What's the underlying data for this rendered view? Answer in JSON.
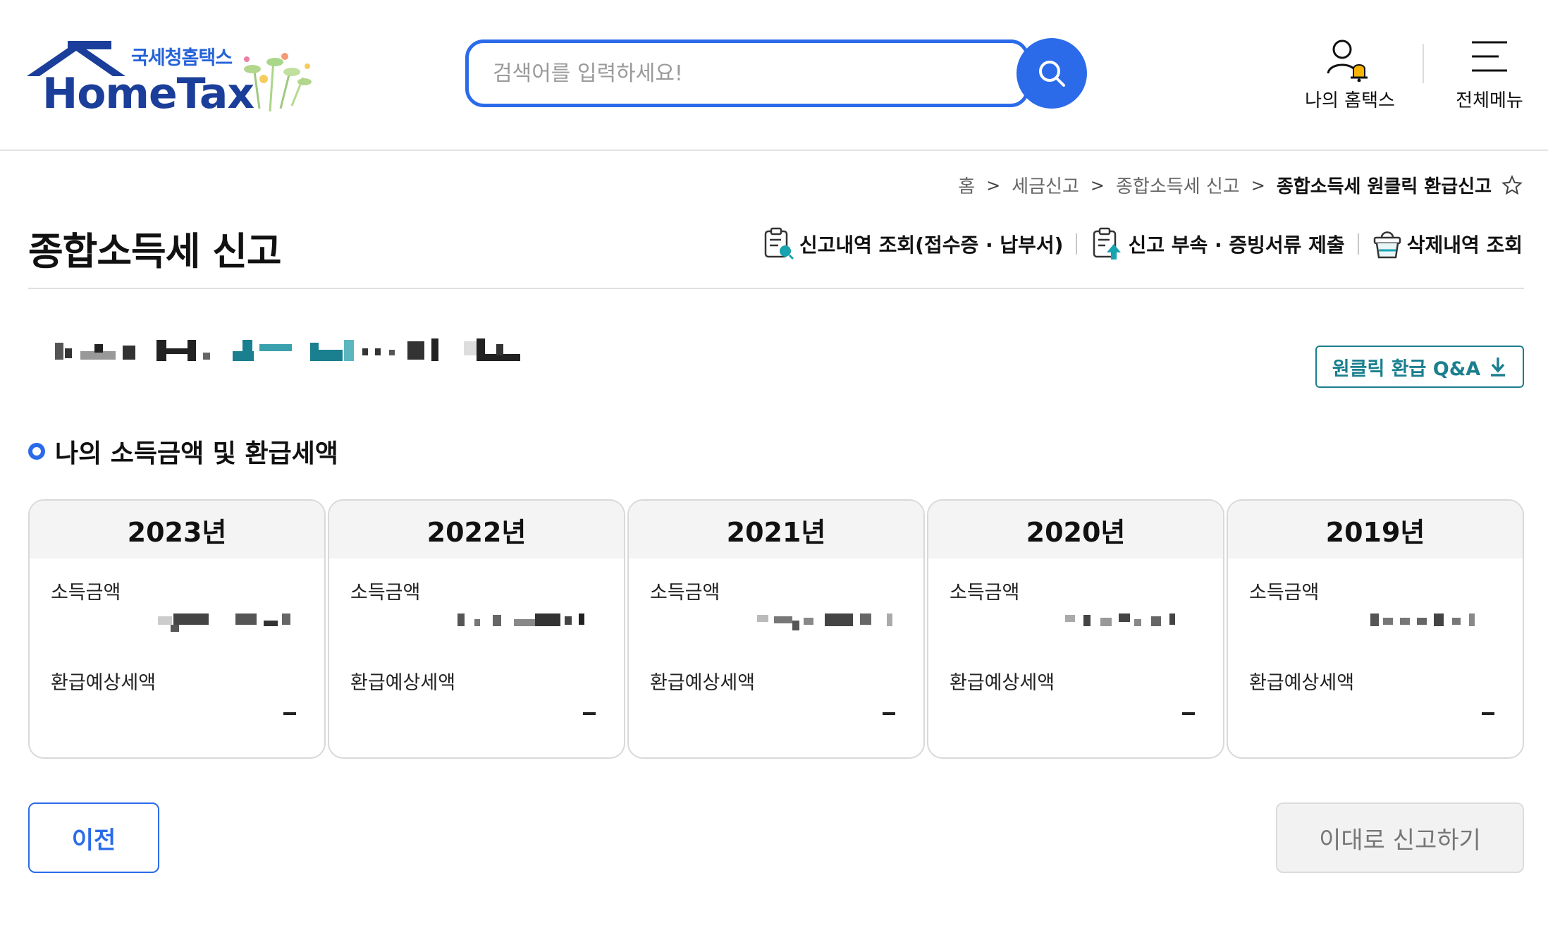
{
  "header": {
    "logo_sub": "국세청홈택스",
    "logo_main": "HomeTax",
    "search_placeholder": "검색어를 입력하세요!",
    "my_hometax": "나의 홈택스",
    "all_menu": "전체메뉴"
  },
  "breadcrumb": [
    "홈",
    "세금신고",
    "종합소득세 신고",
    "종합소득세 원클릭 환급신고"
  ],
  "page_title": "종합소득세 신고",
  "actions": {
    "history": "신고내역 조회(접수증 · 납부서)",
    "attach": "신고 부속 · 증빙서류 제출",
    "deleted": "삭제내역 조회"
  },
  "qa_button": "원클릭 환급 Q&A",
  "section_title": "나의 소득금액 및 환급세액",
  "cards": [
    {
      "year": "2023년",
      "income_label": "소득금액",
      "refund_label": "환급예상세액",
      "refund_value": "-"
    },
    {
      "year": "2022년",
      "income_label": "소득금액",
      "refund_label": "환급예상세액",
      "refund_value": "-"
    },
    {
      "year": "2021년",
      "income_label": "소득금액",
      "refund_label": "환급예상세액",
      "refund_value": "-"
    },
    {
      "year": "2020년",
      "income_label": "소득금액",
      "refund_label": "환급예상세액",
      "refund_value": "-"
    },
    {
      "year": "2019년",
      "income_label": "소득금액",
      "refund_label": "환급예상세액",
      "refund_value": "-"
    }
  ],
  "buttons": {
    "prev": "이전",
    "submit": "이대로 신고하기"
  },
  "colors": {
    "primary": "#2b6bea",
    "teal": "#1a7f8e",
    "logo_navy": "#1b3e9a",
    "card_head_bg": "#f4f4f4"
  }
}
